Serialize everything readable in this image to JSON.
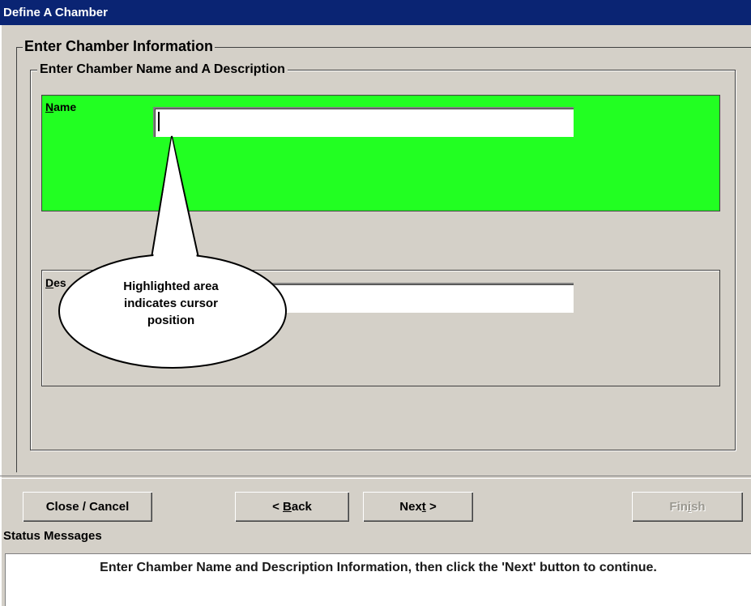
{
  "window": {
    "title": "Define A Chamber"
  },
  "groups": {
    "outer_label": "Enter Chamber Information",
    "inner_label": "Enter Chamber Name and A Description"
  },
  "fields": {
    "name_label_mnemonic": "N",
    "name_label_rest": "ame",
    "name_value": "",
    "description_label_mnemonic": "D",
    "description_label_rest": "es",
    "description_value": ""
  },
  "callout": {
    "line1": "Highlighted area",
    "line2": "indicates cursor",
    "line3": "position"
  },
  "buttons": {
    "close": "Close / Cancel",
    "back_prefix": "< ",
    "back_mnemonic": "B",
    "back_rest": "ack",
    "next_prefix": "Nex",
    "next_mnemonic": "t",
    "next_rest": " >",
    "finish_prefix": "Fin",
    "finish_mnemonic": "i",
    "finish_rest": "sh"
  },
  "status": {
    "header": "Status Messages",
    "message": "Enter Chamber Name and Description Information, then click the 'Next' button to continue."
  },
  "colors": {
    "titlebar": "#0a2473",
    "highlight": "#22ff22",
    "dialog_face": "#d4d0c8"
  }
}
